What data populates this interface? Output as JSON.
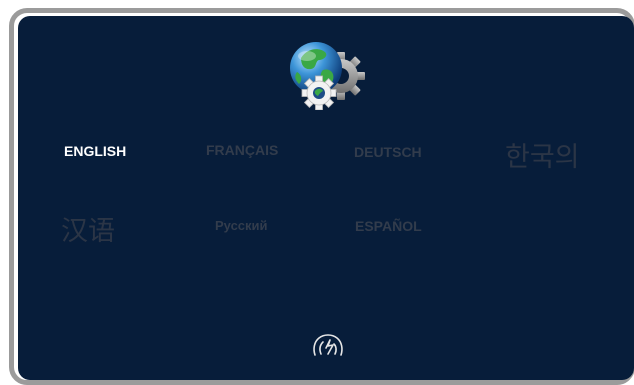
{
  "languages": {
    "english": "ENGLISH",
    "french": "FRANÇAIS",
    "german": "DEUTSCH",
    "korean": "한국의",
    "chinese": "汉语",
    "russian": "Русский",
    "spanish": "ESPAÑOL"
  },
  "selected_language": "english",
  "icons": {
    "header": "globe-gears-icon",
    "footer": "swipe-gesture-icon"
  },
  "colors": {
    "background": "#071d3a",
    "frame": "#9b9b9b",
    "selected_text": "#ffffff",
    "unselected_text": "#323c4c"
  }
}
